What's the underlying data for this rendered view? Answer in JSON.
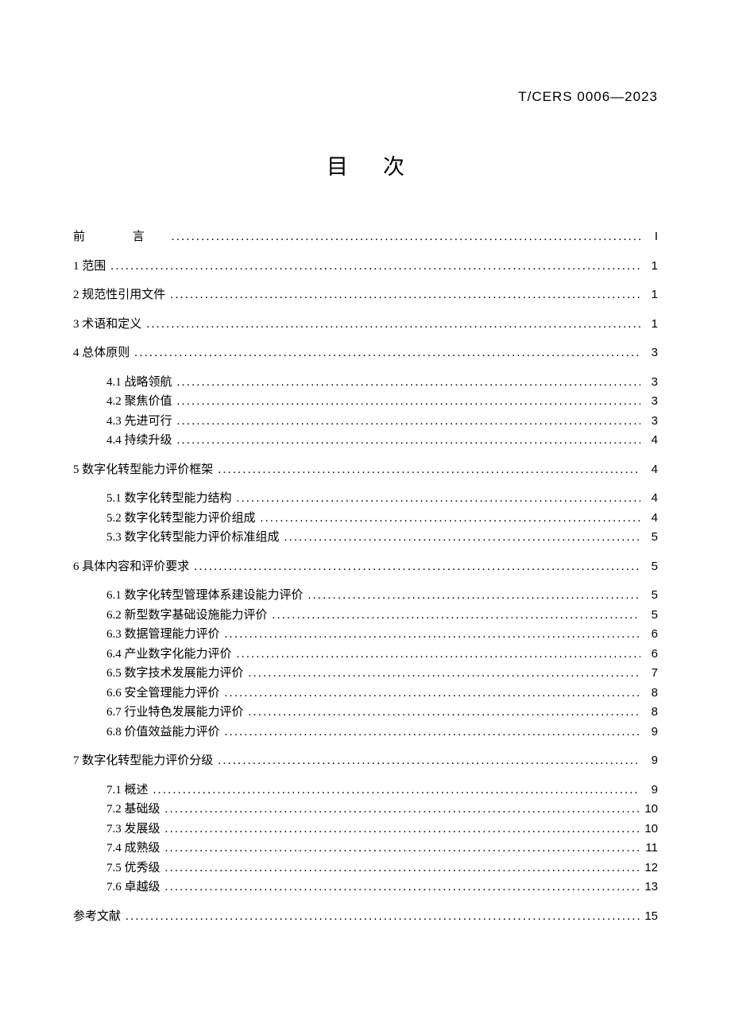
{
  "doc_number": "T/CERS 0006—2023",
  "toc_title": "目次",
  "entries": [
    {
      "level": 1,
      "label": "前    言",
      "page": "I",
      "class": "preface-label"
    },
    {
      "level": 1,
      "label": "1 范围",
      "page": "1"
    },
    {
      "level": 1,
      "label": "2 规范性引用文件",
      "page": "1"
    },
    {
      "level": 1,
      "label": "3 术语和定义",
      "page": "1"
    },
    {
      "level": 1,
      "label": "4 总体原则",
      "page": "3"
    },
    {
      "level": 2,
      "label": "4.1 战略领航",
      "page": "3"
    },
    {
      "level": 2,
      "label": "4.2 聚焦价值",
      "page": "3"
    },
    {
      "level": 2,
      "label": "4.3 先进可行",
      "page": "3"
    },
    {
      "level": 2,
      "label": "4.4 持续升级",
      "page": "4"
    },
    {
      "level": 1,
      "label": "5 数字化转型能力评价框架",
      "page": "4"
    },
    {
      "level": 2,
      "label": "5.1 数字化转型能力结构",
      "page": "4"
    },
    {
      "level": 2,
      "label": "5.2 数字化转型能力评价组成",
      "page": "4"
    },
    {
      "level": 2,
      "label": "5.3 数字化转型能力评价标准组成",
      "page": "5"
    },
    {
      "level": 1,
      "label": "6 具体内容和评价要求",
      "page": "5"
    },
    {
      "level": 2,
      "label": "6.1 数字化转型管理体系建设能力评价",
      "page": "5"
    },
    {
      "level": 2,
      "label": "6.2 新型数字基础设施能力评价",
      "page": "5"
    },
    {
      "level": 2,
      "label": "6.3 数据管理能力评价",
      "page": "6"
    },
    {
      "level": 2,
      "label": "6.4 产业数字化能力评价",
      "page": "6"
    },
    {
      "level": 2,
      "label": "6.5 数字技术发展能力评价",
      "page": "7"
    },
    {
      "level": 2,
      "label": "6.6 安全管理能力评价",
      "page": "8"
    },
    {
      "level": 2,
      "label": "6.7 行业特色发展能力评价",
      "page": "8"
    },
    {
      "level": 2,
      "label": "6.8 价值效益能力评价",
      "page": "9"
    },
    {
      "level": 1,
      "label": "7 数字化转型能力评价分级",
      "page": "9"
    },
    {
      "level": 2,
      "label": "7.1 概述",
      "page": "9"
    },
    {
      "level": 2,
      "label": "7.2 基础级",
      "page": "10"
    },
    {
      "level": 2,
      "label": "7.3 发展级",
      "page": "10"
    },
    {
      "level": 2,
      "label": "7.4 成熟级",
      "page": "11"
    },
    {
      "level": 2,
      "label": "7.5 优秀级",
      "page": "12"
    },
    {
      "level": 2,
      "label": "7.6 卓越级",
      "page": "13"
    },
    {
      "level": 1,
      "label": "参考文献",
      "page": "15"
    }
  ]
}
